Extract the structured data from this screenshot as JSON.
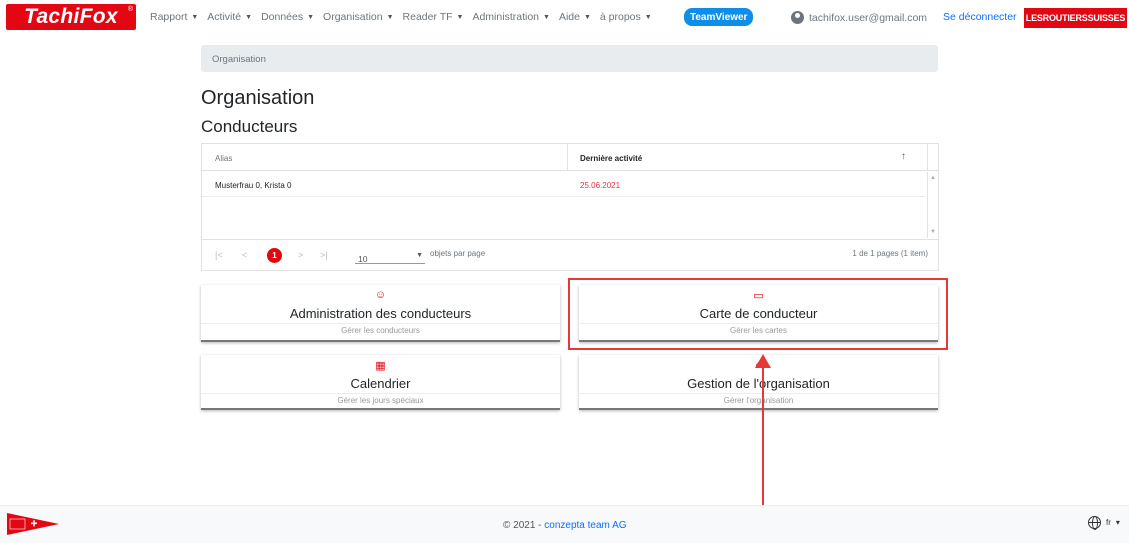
{
  "brand": {
    "logo_text": "TachiFox",
    "logo_mark": "®"
  },
  "nav": {
    "items": [
      {
        "label": "Rapport"
      },
      {
        "label": "Activité"
      },
      {
        "label": "Données"
      },
      {
        "label": "Organisation"
      },
      {
        "label": "Reader TF"
      },
      {
        "label": "Administration"
      },
      {
        "label": "Aide"
      },
      {
        "label": "à propos"
      }
    ],
    "teamviewer": "TeamViewer",
    "user_email": "tachifox.user@gmail.com",
    "logout": "Se déconnecter",
    "org": "LESROUTIERSSUISSES"
  },
  "breadcrumb": "Organisation",
  "page": {
    "title": "Organisation",
    "subtitle": "Conducteurs"
  },
  "grid": {
    "columns": [
      "Alias",
      "Dernière activité"
    ],
    "sort_icon": "↑",
    "rows": [
      {
        "alias": "Musterfrau 0, Krista 0",
        "last_activity": "25.06.2021"
      }
    ],
    "pager": {
      "first": "|<",
      "prev": "<",
      "current": "1",
      "next": ">",
      "last": ">|",
      "page_size": "10",
      "page_size_label": "objets par page",
      "info": "1 de 1 pages (1 item)"
    }
  },
  "cards": [
    {
      "icon": "driver-face-icon",
      "icon_glyph": "☺",
      "title": "Administration des conducteurs",
      "subtitle": "Gérer les conducteurs"
    },
    {
      "icon": "driver-card-icon",
      "icon_glyph": "▭",
      "title": "Carte de conducteur",
      "subtitle": "Gérer les cartes"
    },
    {
      "icon": "calendar-icon",
      "icon_glyph": "▦",
      "title": "Calendrier",
      "subtitle": "Gérer les jours spéciaux"
    },
    {
      "icon": "institution-icon",
      "icon_glyph": "⌂",
      "title": "Gestion de l'organisation",
      "subtitle": "Gérer l'organisation"
    }
  ],
  "footer": {
    "copyright": "© 2021 - ",
    "company": "conzepta team AG",
    "language": "fr"
  },
  "colors": {
    "brand_red": "#e30613",
    "link_blue": "#0d6efd",
    "teamviewer_blue": "#0e8ee9",
    "highlight_red": "#e53935"
  }
}
